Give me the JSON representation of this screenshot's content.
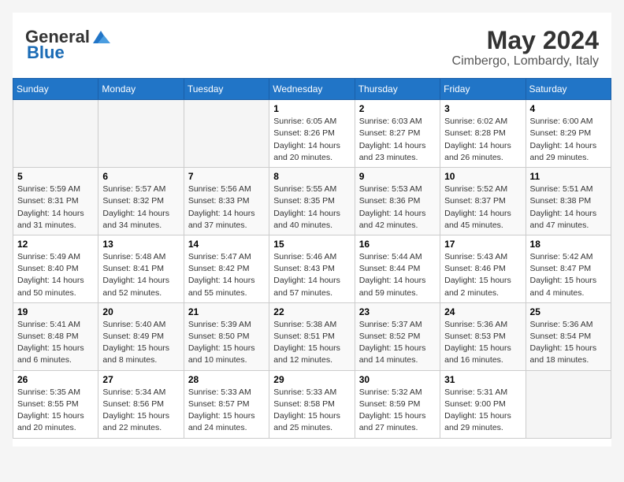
{
  "header": {
    "logo_general": "General",
    "logo_blue": "Blue",
    "month_title": "May 2024",
    "subtitle": "Cimbergo, Lombardy, Italy"
  },
  "days_of_week": [
    "Sunday",
    "Monday",
    "Tuesday",
    "Wednesday",
    "Thursday",
    "Friday",
    "Saturday"
  ],
  "weeks": [
    [
      {
        "day": "",
        "info": ""
      },
      {
        "day": "",
        "info": ""
      },
      {
        "day": "",
        "info": ""
      },
      {
        "day": "1",
        "info": "Sunrise: 6:05 AM\nSunset: 8:26 PM\nDaylight: 14 hours\nand 20 minutes."
      },
      {
        "day": "2",
        "info": "Sunrise: 6:03 AM\nSunset: 8:27 PM\nDaylight: 14 hours\nand 23 minutes."
      },
      {
        "day": "3",
        "info": "Sunrise: 6:02 AM\nSunset: 8:28 PM\nDaylight: 14 hours\nand 26 minutes."
      },
      {
        "day": "4",
        "info": "Sunrise: 6:00 AM\nSunset: 8:29 PM\nDaylight: 14 hours\nand 29 minutes."
      }
    ],
    [
      {
        "day": "5",
        "info": "Sunrise: 5:59 AM\nSunset: 8:31 PM\nDaylight: 14 hours\nand 31 minutes."
      },
      {
        "day": "6",
        "info": "Sunrise: 5:57 AM\nSunset: 8:32 PM\nDaylight: 14 hours\nand 34 minutes."
      },
      {
        "day": "7",
        "info": "Sunrise: 5:56 AM\nSunset: 8:33 PM\nDaylight: 14 hours\nand 37 minutes."
      },
      {
        "day": "8",
        "info": "Sunrise: 5:55 AM\nSunset: 8:35 PM\nDaylight: 14 hours\nand 40 minutes."
      },
      {
        "day": "9",
        "info": "Sunrise: 5:53 AM\nSunset: 8:36 PM\nDaylight: 14 hours\nand 42 minutes."
      },
      {
        "day": "10",
        "info": "Sunrise: 5:52 AM\nSunset: 8:37 PM\nDaylight: 14 hours\nand 45 minutes."
      },
      {
        "day": "11",
        "info": "Sunrise: 5:51 AM\nSunset: 8:38 PM\nDaylight: 14 hours\nand 47 minutes."
      }
    ],
    [
      {
        "day": "12",
        "info": "Sunrise: 5:49 AM\nSunset: 8:40 PM\nDaylight: 14 hours\nand 50 minutes."
      },
      {
        "day": "13",
        "info": "Sunrise: 5:48 AM\nSunset: 8:41 PM\nDaylight: 14 hours\nand 52 minutes."
      },
      {
        "day": "14",
        "info": "Sunrise: 5:47 AM\nSunset: 8:42 PM\nDaylight: 14 hours\nand 55 minutes."
      },
      {
        "day": "15",
        "info": "Sunrise: 5:46 AM\nSunset: 8:43 PM\nDaylight: 14 hours\nand 57 minutes."
      },
      {
        "day": "16",
        "info": "Sunrise: 5:44 AM\nSunset: 8:44 PM\nDaylight: 14 hours\nand 59 minutes."
      },
      {
        "day": "17",
        "info": "Sunrise: 5:43 AM\nSunset: 8:46 PM\nDaylight: 15 hours\nand 2 minutes."
      },
      {
        "day": "18",
        "info": "Sunrise: 5:42 AM\nSunset: 8:47 PM\nDaylight: 15 hours\nand 4 minutes."
      }
    ],
    [
      {
        "day": "19",
        "info": "Sunrise: 5:41 AM\nSunset: 8:48 PM\nDaylight: 15 hours\nand 6 minutes."
      },
      {
        "day": "20",
        "info": "Sunrise: 5:40 AM\nSunset: 8:49 PM\nDaylight: 15 hours\nand 8 minutes."
      },
      {
        "day": "21",
        "info": "Sunrise: 5:39 AM\nSunset: 8:50 PM\nDaylight: 15 hours\nand 10 minutes."
      },
      {
        "day": "22",
        "info": "Sunrise: 5:38 AM\nSunset: 8:51 PM\nDaylight: 15 hours\nand 12 minutes."
      },
      {
        "day": "23",
        "info": "Sunrise: 5:37 AM\nSunset: 8:52 PM\nDaylight: 15 hours\nand 14 minutes."
      },
      {
        "day": "24",
        "info": "Sunrise: 5:36 AM\nSunset: 8:53 PM\nDaylight: 15 hours\nand 16 minutes."
      },
      {
        "day": "25",
        "info": "Sunrise: 5:36 AM\nSunset: 8:54 PM\nDaylight: 15 hours\nand 18 minutes."
      }
    ],
    [
      {
        "day": "26",
        "info": "Sunrise: 5:35 AM\nSunset: 8:55 PM\nDaylight: 15 hours\nand 20 minutes."
      },
      {
        "day": "27",
        "info": "Sunrise: 5:34 AM\nSunset: 8:56 PM\nDaylight: 15 hours\nand 22 minutes."
      },
      {
        "day": "28",
        "info": "Sunrise: 5:33 AM\nSunset: 8:57 PM\nDaylight: 15 hours\nand 24 minutes."
      },
      {
        "day": "29",
        "info": "Sunrise: 5:33 AM\nSunset: 8:58 PM\nDaylight: 15 hours\nand 25 minutes."
      },
      {
        "day": "30",
        "info": "Sunrise: 5:32 AM\nSunset: 8:59 PM\nDaylight: 15 hours\nand 27 minutes."
      },
      {
        "day": "31",
        "info": "Sunrise: 5:31 AM\nSunset: 9:00 PM\nDaylight: 15 hours\nand 29 minutes."
      },
      {
        "day": "",
        "info": ""
      }
    ]
  ]
}
